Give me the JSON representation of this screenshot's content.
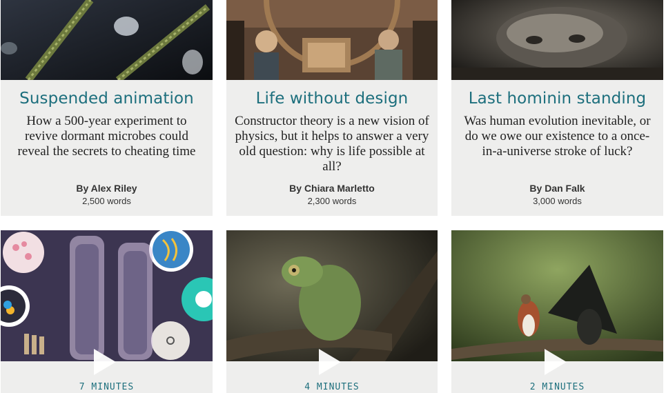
{
  "articles": [
    {
      "title": "Suspended animation",
      "dek": "How a 500-year experiment to revive dormant microbes could reveal the secrets to cheating time",
      "byline_prefix": "By",
      "author": "Alex Riley",
      "word_count": "2,500",
      "word_label": "words",
      "image": "microbes-photo"
    },
    {
      "title": "Life without design",
      "dek": "Constructor theory is a new vision of physics, but it helps to answer a very old question: why is life possible at all?",
      "byline_prefix": "By",
      "author": "Chiara Marletto",
      "word_count": "2,300",
      "word_label": "words",
      "image": "machine-illustration"
    },
    {
      "title": "Last hominin standing",
      "dek": "Was human evolution inevitable, or do we owe our existence to a once-in-a-universe stroke of luck?",
      "byline_prefix": "By",
      "author": "Dan Falk",
      "word_count": "3,000",
      "word_label": "words",
      "image": "hominin-skull-photo"
    }
  ],
  "videos": [
    {
      "duration_value": "7",
      "duration_label": "MINUTES",
      "image": "human-cells-illustration"
    },
    {
      "duration_value": "4",
      "duration_label": "MINUTES",
      "image": "chameleon-photo"
    },
    {
      "duration_value": "2",
      "duration_label": "MINUTES",
      "image": "bird-photo"
    }
  ],
  "colors": {
    "title": "#1d6f7d",
    "card_bg": "#eeeeed"
  }
}
